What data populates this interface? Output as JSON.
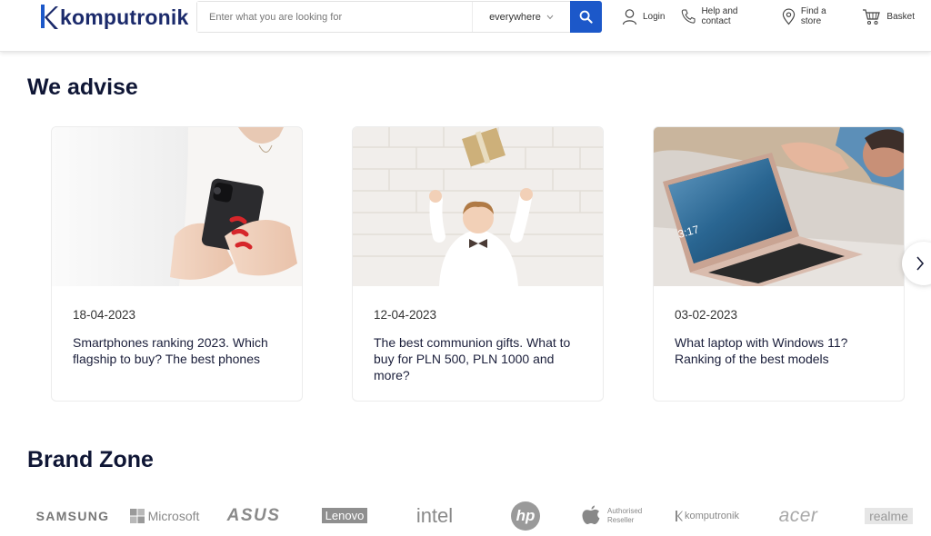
{
  "header": {
    "logo_text": "komputronik",
    "search": {
      "placeholder": "Enter what you are looking for",
      "scope": "everywhere"
    },
    "actions": [
      {
        "label": "Login",
        "icon": "user-icon"
      },
      {
        "label": "Help and contact",
        "icon": "phone-icon"
      },
      {
        "label": "Find a store",
        "icon": "location-pin-icon"
      },
      {
        "label": "Basket",
        "icon": "cart-icon"
      }
    ]
  },
  "advise": {
    "title": "We advise",
    "cards": [
      {
        "date": "18-04-2023",
        "title": "Smartphones ranking 2023. Which flagship to buy? The best phones"
      },
      {
        "date": "12-04-2023",
        "title": "The best communion gifts. What to buy for PLN 500, PLN 1000 and more?"
      },
      {
        "date": "03-02-2023",
        "title": "What laptop with Windows 11? Ranking of the best models"
      }
    ]
  },
  "brand_zone": {
    "title": "Brand Zone",
    "brands": [
      "SAMSUNG",
      "Microsoft",
      "ASUS",
      "Lenovo",
      "intel",
      "hp",
      "Authorised Reseller",
      "komputronik",
      "acer",
      "realme"
    ]
  },
  "colors": {
    "brand_blue": "#1c58c9",
    "navy": "#0f1635"
  }
}
